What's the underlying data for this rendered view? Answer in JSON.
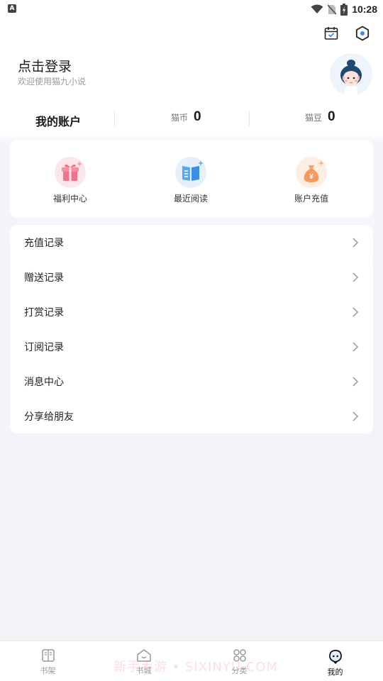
{
  "status_bar": {
    "time": "10:28",
    "left_badge": "A"
  },
  "header": {
    "icons": [
      "calendar-check-icon",
      "settings-icon"
    ]
  },
  "login": {
    "title": "点击登录",
    "subtitle": "欢迎使用猫九小说"
  },
  "account": {
    "title": "我的账户",
    "coins": {
      "label": "猫币",
      "value": "0"
    },
    "beans": {
      "label": "猫豆",
      "value": "0"
    }
  },
  "quick_actions": [
    {
      "label": "福利中心",
      "icon": "gift-icon",
      "color": "#fde6ea"
    },
    {
      "label": "最近阅读",
      "icon": "book-icon",
      "color": "#e4f1fc"
    },
    {
      "label": "账户充值",
      "icon": "money-bag-icon",
      "color": "#fdeee4"
    }
  ],
  "menu": [
    {
      "label": "充值记录"
    },
    {
      "label": "赠送记录"
    },
    {
      "label": "打赏记录"
    },
    {
      "label": "订阅记录"
    },
    {
      "label": "消息中心"
    },
    {
      "label": "分享给朋友"
    }
  ],
  "tabs": [
    {
      "label": "书架",
      "icon": "bookshelf-icon",
      "active": false
    },
    {
      "label": "书城",
      "icon": "bookstore-icon",
      "active": false
    },
    {
      "label": "分类",
      "icon": "category-icon",
      "active": false
    },
    {
      "label": "我的",
      "icon": "profile-icon",
      "active": true
    }
  ],
  "watermark": "新手手游 • SIXINYU.COM"
}
